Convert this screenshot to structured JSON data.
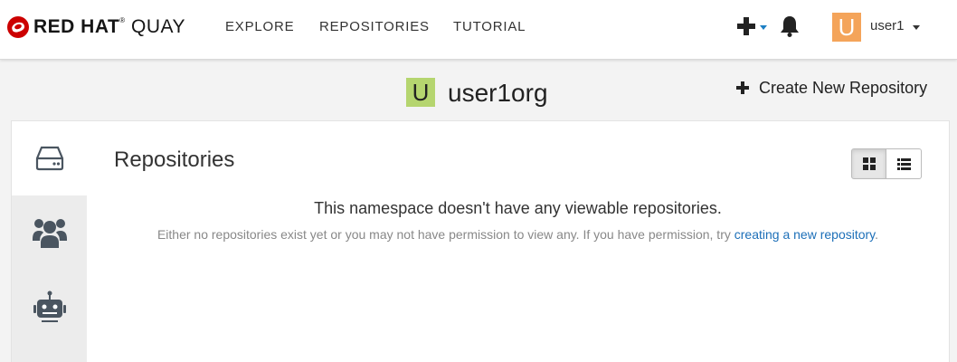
{
  "brand": {
    "part1": "RED HAT",
    "reg": "®",
    "part2": " QUAY"
  },
  "nav": {
    "explore": "EXPLORE",
    "repositories": "REPOSITORIES",
    "tutorial": "TUTORIAL"
  },
  "user": {
    "avatar_letter": "U",
    "name": "user1",
    "avatar_color": "#f4a45a"
  },
  "org": {
    "avatar_letter": "U",
    "name": "user1org",
    "avatar_color": "#b5d56f"
  },
  "actions": {
    "create_repo": "Create New Repository"
  },
  "repositories": {
    "title": "Repositories",
    "empty_message": "This namespace doesn't have any viewable repositories.",
    "empty_detail": "Either no repositories exist yet or you may not have permission to view any. If you have permission, try ",
    "empty_link": "creating a new repository",
    "empty_end": "."
  },
  "icons": {
    "plus_menu": "plus-icon",
    "notifications": "bell-icon",
    "repos_tab": "hard-drive-icon",
    "teams_tab": "users-icon",
    "robots_tab": "robot-icon",
    "grid_view": "grid-icon",
    "list_view": "list-icon"
  },
  "colors": {
    "brand_red": "#cc0000",
    "link": "#1c6fb8",
    "dropdown_caret": "#1c7fc4"
  }
}
